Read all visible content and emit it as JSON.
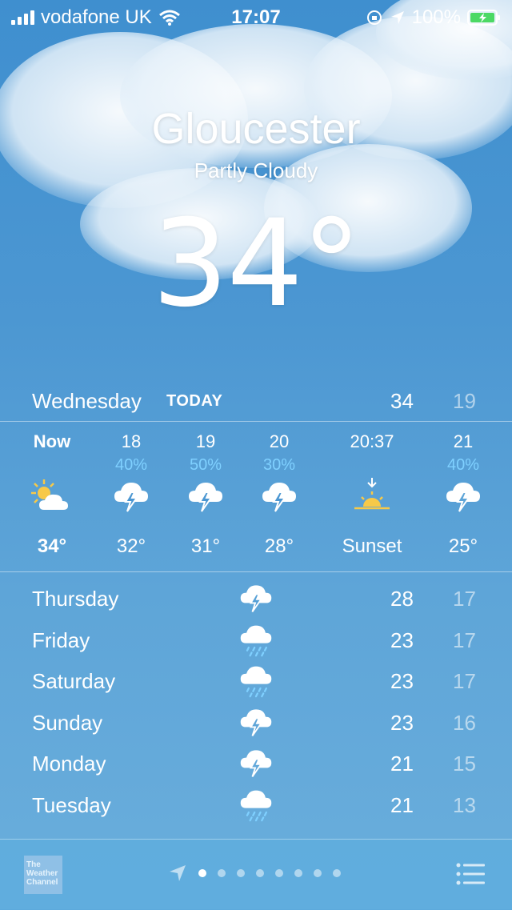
{
  "status_bar": {
    "carrier": "vodafone UK",
    "time": "17:07",
    "battery": "100%"
  },
  "location": {
    "city": "Gloucester",
    "condition": "Partly Cloudy",
    "temperature": "34°"
  },
  "today": {
    "day": "Wednesday",
    "tag": "TODAY",
    "high": "34",
    "low": "19"
  },
  "hourly": [
    {
      "label": "Now",
      "pop": "",
      "icon": "partly-cloudy-sun-icon",
      "temp": "34°"
    },
    {
      "label": "18",
      "pop": "40%",
      "icon": "thunderstorm-icon",
      "temp": "32°"
    },
    {
      "label": "19",
      "pop": "50%",
      "icon": "thunderstorm-icon",
      "temp": "31°"
    },
    {
      "label": "20",
      "pop": "30%",
      "icon": "thunderstorm-icon",
      "temp": "28°"
    },
    {
      "label": "20:37",
      "pop": "",
      "icon": "sunset-icon",
      "temp": "Sunset"
    },
    {
      "label": "21",
      "pop": "40%",
      "icon": "thunderstorm-icon",
      "temp": "25°"
    }
  ],
  "daily": [
    {
      "day": "Thursday",
      "icon": "thunderstorm-icon",
      "high": "28",
      "low": "17"
    },
    {
      "day": "Friday",
      "icon": "rain-icon",
      "high": "23",
      "low": "17"
    },
    {
      "day": "Saturday",
      "icon": "rain-icon",
      "high": "23",
      "low": "17"
    },
    {
      "day": "Sunday",
      "icon": "thunderstorm-icon",
      "high": "23",
      "low": "16"
    },
    {
      "day": "Monday",
      "icon": "thunderstorm-icon",
      "high": "21",
      "low": "15"
    },
    {
      "day": "Tuesday",
      "icon": "rain-icon",
      "high": "21",
      "low": "13"
    }
  ],
  "footer": {
    "logo_text": "The Weather Channel",
    "page_count": 8,
    "active_page": 1
  },
  "colors": {
    "precip_blue": "#7fd0ff",
    "sun_yellow": "#f7c948"
  }
}
